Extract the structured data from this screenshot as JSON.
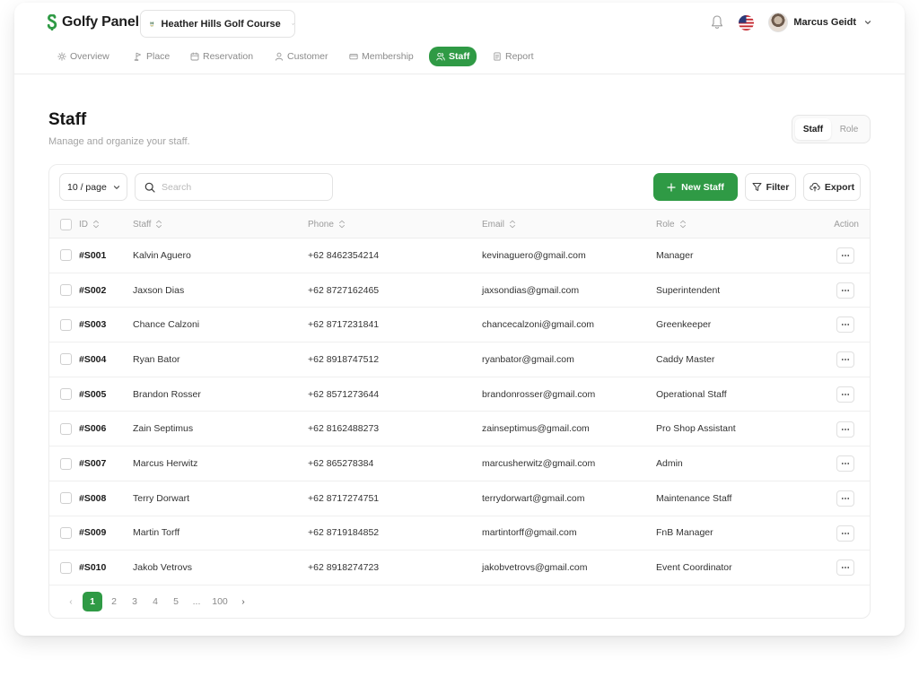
{
  "app": {
    "name": "Golfy Panel"
  },
  "course": {
    "name": "Heather Hills Golf Course"
  },
  "user": {
    "name": "Marcus Geidt"
  },
  "colors": {
    "accent": "#2f9a45"
  },
  "icons": {
    "logo": "golfy-logo-icon",
    "course": "course-logo-icon",
    "bell": "bell-icon",
    "flag": "us-flag-icon",
    "chevron": "chevron-down-icon",
    "search": "search-icon",
    "plus": "plus-icon",
    "filter": "filter-icon",
    "export": "cloud-upload-icon",
    "more": "more-horizontal-icon"
  },
  "nav": {
    "items": [
      {
        "label": "Overview"
      },
      {
        "label": "Place"
      },
      {
        "label": "Reservation"
      },
      {
        "label": "Customer"
      },
      {
        "label": "Membership"
      },
      {
        "label": "Staff"
      },
      {
        "label": "Report"
      }
    ],
    "active_index": 5
  },
  "page": {
    "title": "Staff",
    "subtitle": "Manage and organize your staff.",
    "toggle": [
      {
        "label": "Staff"
      },
      {
        "label": "Role"
      }
    ]
  },
  "toolbar": {
    "page_size": "10 / page",
    "search_placeholder": "Search",
    "new_label": "New Staff",
    "filter_label": "Filter",
    "export_label": "Export"
  },
  "table": {
    "columns": [
      {
        "label": "ID"
      },
      {
        "label": "Staff"
      },
      {
        "label": "Phone"
      },
      {
        "label": "Email"
      },
      {
        "label": "Role"
      },
      {
        "label": "Action"
      }
    ],
    "rows": [
      {
        "id": "#S001",
        "name": "Kalvin Aguero",
        "phone": "+62 8462354214",
        "email": "kevinaguero@gmail.com",
        "role": "Manager"
      },
      {
        "id": "#S002",
        "name": "Jaxson Dias",
        "phone": "+62 8727162465",
        "email": "jaxsondias@gmail.com",
        "role": "Superintendent"
      },
      {
        "id": "#S003",
        "name": "Chance Calzoni",
        "phone": "+62 8717231841",
        "email": "chancecalzoni@gmail.com",
        "role": "Greenkeeper"
      },
      {
        "id": "#S004",
        "name": "Ryan Bator",
        "phone": "+62 8918747512",
        "email": "ryanbator@gmail.com",
        "role": "Caddy Master"
      },
      {
        "id": "#S005",
        "name": "Brandon Rosser",
        "phone": "+62 8571273644",
        "email": "brandonrosser@gmail.com",
        "role": "Operational Staff"
      },
      {
        "id": "#S006",
        "name": "Zain Septimus",
        "phone": "+62 8162488273",
        "email": "zainseptimus@gmail.com",
        "role": "Pro Shop Assistant"
      },
      {
        "id": "#S007",
        "name": "Marcus Herwitz",
        "phone": "+62 865278384",
        "email": "marcusherwitz@gmail.com",
        "role": "Admin"
      },
      {
        "id": "#S008",
        "name": "Terry Dorwart",
        "phone": "+62 8717274751",
        "email": "terrydorwart@gmail.com",
        "role": "Maintenance Staff"
      },
      {
        "id": "#S009",
        "name": "Martin Torff",
        "phone": "+62 8719184852",
        "email": "martintorff@gmail.com",
        "role": "FnB Manager"
      },
      {
        "id": "#S010",
        "name": "Jakob Vetrovs",
        "phone": "+62 8918274723",
        "email": "jakobvetrovs@gmail.com",
        "role": "Event Coordinator"
      }
    ]
  },
  "pagination": {
    "prev": "‹",
    "next": "›",
    "pages": [
      "1",
      "2",
      "3",
      "4",
      "5",
      "...",
      "100"
    ],
    "current": "1"
  }
}
